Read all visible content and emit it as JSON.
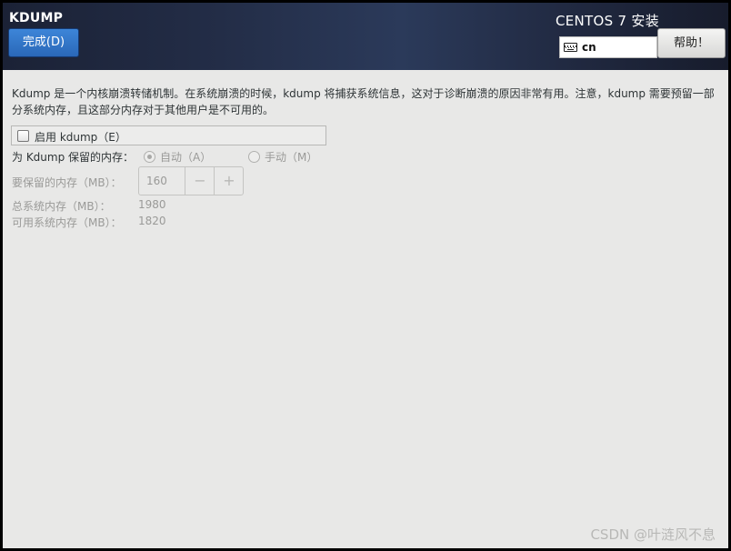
{
  "header": {
    "title": "KDUMP",
    "done_label": "完成(D)",
    "product_title": "CENTOS 7 安装",
    "keyboard_layout": "cn",
    "help_label": "帮助！"
  },
  "main": {
    "description": "Kdump 是一个内核崩溃转储机制。在系统崩溃的时候，kdump 将捕获系统信息，这对于诊断崩溃的原因非常有用。注意，kdump 需要预留一部分系统内存，且这部分内存对于其他用户是不可用的。",
    "enable_label": "启用 kdump（E）",
    "enable_checked": false,
    "reserve_label": "为 Kdump 保留的内存：",
    "reserve_options": [
      {
        "label": "自动（A）",
        "selected": true
      },
      {
        "label": "手动（M）",
        "selected": false
      }
    ],
    "memory_reserved_label": "要保留的内存（MB）：",
    "memory_reserved_value": "160",
    "spin_minus": "−",
    "spin_plus": "+",
    "total_memory_label": "总系统内存（MB）：",
    "total_memory_value": "1980",
    "available_memory_label": "可用系统内存（MB）：",
    "available_memory_value": "1820"
  },
  "watermark": "CSDN @叶涟风不息",
  "icons": {
    "keyboard": "keyboard-icon"
  },
  "colors": {
    "done_button": "#2f72c4",
    "header_bg": "#232d47",
    "page_bg": "#e8e8e7"
  }
}
